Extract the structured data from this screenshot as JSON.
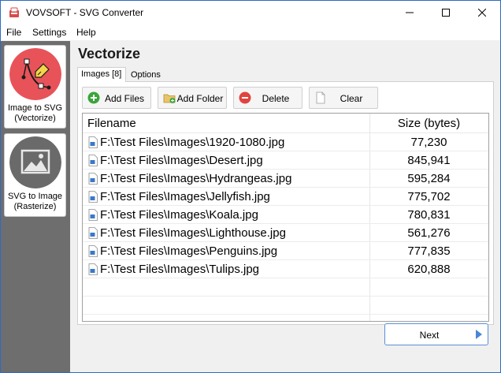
{
  "window": {
    "title": "VOVSOFT - SVG Converter",
    "accent": "#2b6cc4"
  },
  "menu": {
    "file": "File",
    "settings": "Settings",
    "help": "Help"
  },
  "sidebar": {
    "items": [
      {
        "label_line1": "Image to SVG",
        "label_line2": "(Vectorize)",
        "icon": "vectorize-icon",
        "color": "#e8535a"
      },
      {
        "label_line1": "SVG to Image",
        "label_line2": "(Rasterize)",
        "icon": "image-icon",
        "color": "#6a6a6a"
      }
    ]
  },
  "main": {
    "title": "Vectorize",
    "tabs": [
      {
        "label": "Images [8]",
        "active": true
      },
      {
        "label": "Options",
        "active": false
      }
    ],
    "toolbar": {
      "add_files": "Add Files",
      "add_folder": "Add Folder",
      "delete": "Delete",
      "clear": "Clear"
    },
    "table": {
      "headers": {
        "filename": "Filename",
        "size": "Size (bytes)"
      },
      "rows": [
        {
          "filename": "F:\\Test Files\\Images\\1920-1080.jpg",
          "size": "77,230"
        },
        {
          "filename": "F:\\Test Files\\Images\\Desert.jpg",
          "size": "845,941"
        },
        {
          "filename": "F:\\Test Files\\Images\\Hydrangeas.jpg",
          "size": "595,284"
        },
        {
          "filename": "F:\\Test Files\\Images\\Jellyfish.jpg",
          "size": "775,702"
        },
        {
          "filename": "F:\\Test Files\\Images\\Koala.jpg",
          "size": "780,831"
        },
        {
          "filename": "F:\\Test Files\\Images\\Lighthouse.jpg",
          "size": "561,276"
        },
        {
          "filename": "F:\\Test Files\\Images\\Penguins.jpg",
          "size": "777,835"
        },
        {
          "filename": "F:\\Test Files\\Images\\Tulips.jpg",
          "size": "620,888"
        }
      ]
    },
    "next_label": "Next"
  }
}
